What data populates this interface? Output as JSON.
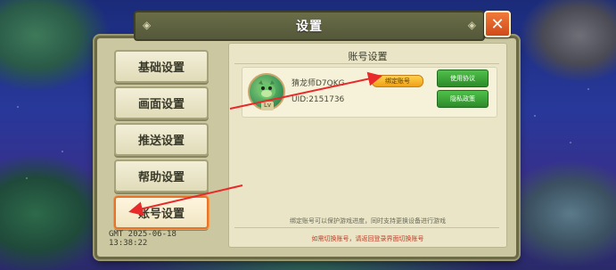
{
  "dialog": {
    "title": "设置",
    "close_symbol": "✕"
  },
  "sidebar": {
    "items": [
      {
        "label": "基础设置",
        "active": false
      },
      {
        "label": "画面设置",
        "active": false
      },
      {
        "label": "推送设置",
        "active": false
      },
      {
        "label": "帮助设置",
        "active": false
      },
      {
        "label": "账号设置",
        "active": true
      }
    ],
    "timestamp": "GMT 2025-06-18 13:38:22"
  },
  "account": {
    "section_title": "账号设置",
    "username": "猜龙师D7QKG",
    "uid": "UID:2151736",
    "bind_label": "绑定账号",
    "terms_label": "使用协议",
    "privacy_label": "隐私政策",
    "bind_notice": "绑定账号可以保护游戏进度，同时支持更换设备进行游戏",
    "switch_notice": "如需切换账号，请返回登录界面切换账号",
    "avatar_tag": "Lv"
  },
  "colors": {
    "accent_orange": "#e8742a",
    "close_red": "#d04a1a",
    "action_green": "#2e8a2a",
    "bind_yellow": "#f0a01a",
    "annotation_red": "#e82a2a"
  },
  "icons": [
    "close-icon",
    "dragon-avatar-icon",
    "annotation-arrow-icon"
  ]
}
